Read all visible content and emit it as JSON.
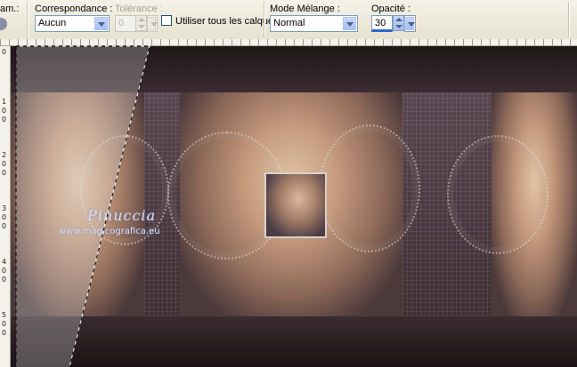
{
  "toolbar": {
    "cut_label": "am.:",
    "match": {
      "label": "Correspondance :",
      "value": "Aucun"
    },
    "tolerance": {
      "label": "Tolérance :",
      "value": "0"
    },
    "all_layers": {
      "label": "Utiliser tous les calques",
      "checked": false
    },
    "blend": {
      "label": "Mode Mélange :",
      "value": "Normal"
    },
    "opacity": {
      "label": "Opacité :",
      "value": "30"
    }
  },
  "rulers": {
    "left_labels": [
      "0",
      "1\n0\n0",
      "2\n0\n0",
      "3\n0\n0",
      "4\n0\n0",
      "5\n0\n0"
    ]
  },
  "canvas": {
    "watermark_name": "Pinuccia",
    "watermark_url": "www.magicografica.eu"
  },
  "colors": {
    "accent": "#316ac5",
    "canvas_dark": "#2c2022",
    "canvas_mauve": "#49393f"
  }
}
